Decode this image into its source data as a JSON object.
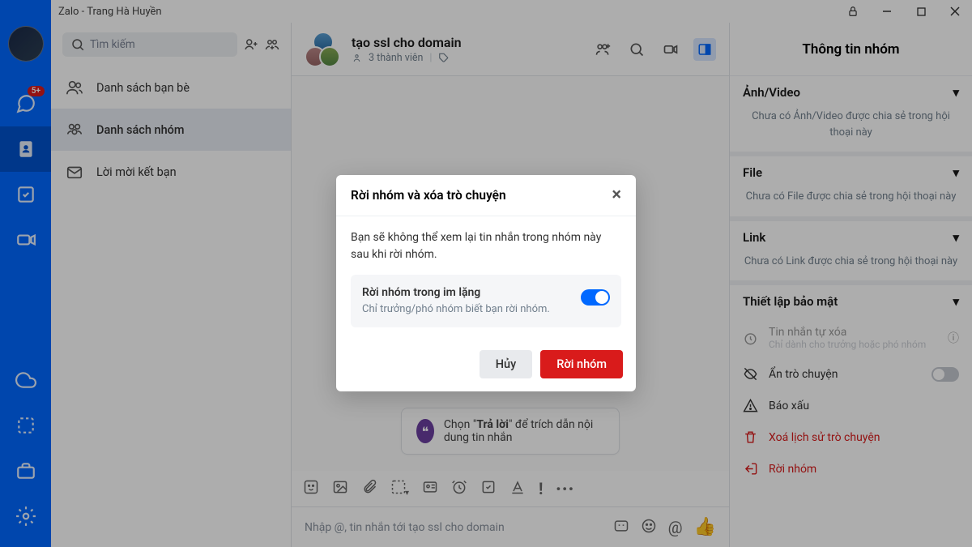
{
  "titlebar": {
    "title": "Zalo - Trang Hà Huyền"
  },
  "rail": {
    "badge": "5+"
  },
  "search": {
    "placeholder": "Tìm kiếm"
  },
  "nav": {
    "friends": "Danh sách bạn bè",
    "groups": "Danh sách nhóm",
    "invites": "Lời mời kết bạn"
  },
  "chat": {
    "title": "tạo ssl cho domain",
    "members": "3 thành viên",
    "tip_prefix": "Chọn \"",
    "tip_bold": "Trả lời",
    "tip_suffix": "\" để trích dẫn nội dung tin nhắn",
    "composer_placeholder": "Nhập @, tin nhắn tới tạo ssl cho domain"
  },
  "info": {
    "title": "Thông tin nhóm",
    "sections": {
      "media": {
        "title": "Ảnh/Video",
        "body": "Chưa có Ảnh/Video được chia sẻ trong hội thoại này"
      },
      "file": {
        "title": "File",
        "body": "Chưa có File được chia sẻ trong hội thoại này"
      },
      "link": {
        "title": "Link",
        "body": "Chưa có Link được chia sẻ trong hội thoại này"
      }
    },
    "security": {
      "title": "Thiết lập bảo mật",
      "auto_delete": "Tin nhắn tự xóa",
      "auto_delete_note": "Chỉ dành cho trưởng hoặc phó nhóm",
      "hide": "Ẩn trò chuyện",
      "report": "Báo xấu",
      "clear": "Xoá lịch sử trò chuyện",
      "leave": "Rời nhóm"
    }
  },
  "modal": {
    "title": "Rời nhóm và xóa trò chuyện",
    "body": "Bạn sẽ không thể xem lại tin nhắn trong nhóm này sau khi rời nhóm.",
    "opt_label": "Rời nhóm trong im lặng",
    "opt_desc": "Chỉ trưởng/phó nhóm biết bạn rời nhóm.",
    "cancel": "Hủy",
    "confirm": "Rời nhóm"
  }
}
